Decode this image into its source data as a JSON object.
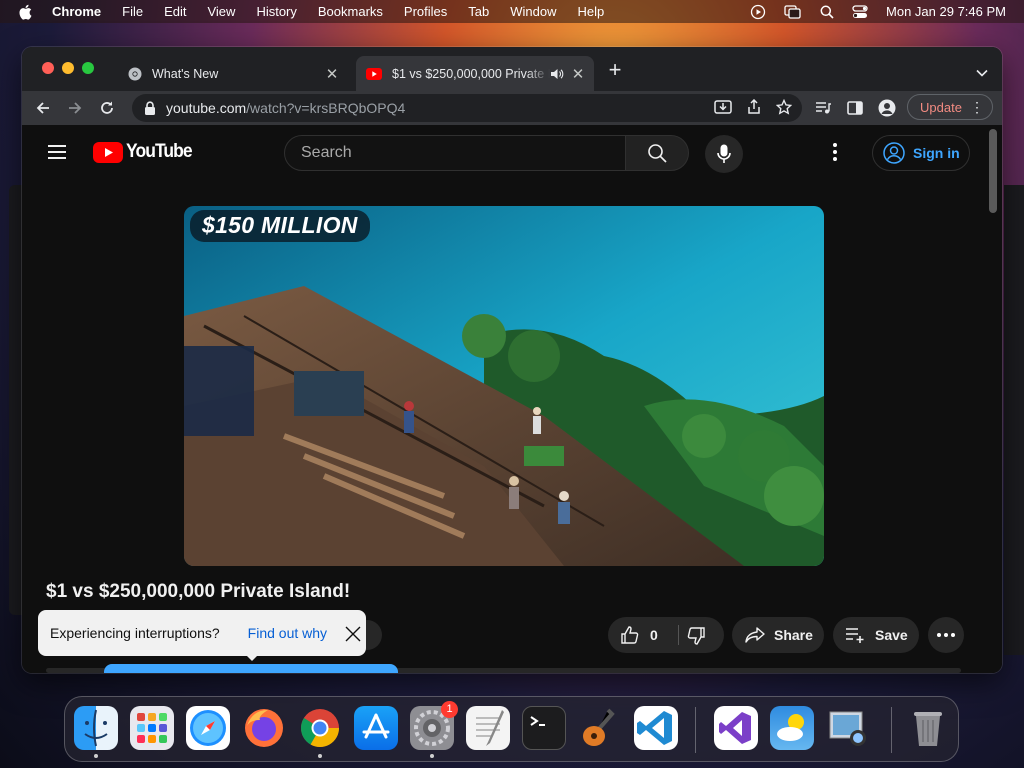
{
  "menubar": {
    "app_name": "Chrome",
    "items": [
      "File",
      "Edit",
      "View",
      "History",
      "Bookmarks",
      "Profiles",
      "Tab",
      "Window",
      "Help"
    ],
    "clock": "Mon Jan 29  7:46 PM"
  },
  "browser": {
    "tabs": [
      {
        "title": "What's New",
        "icon": "chrome-icon"
      },
      {
        "title": "$1 vs $250,000,000 Private Island!",
        "icon": "youtube-icon",
        "audio": "speaker-icon"
      }
    ],
    "url_host": "youtube.com",
    "url_path": "/watch?v=krsBRQbOPQ4",
    "update_label": "Update"
  },
  "youtube": {
    "logo_text": "YouTube",
    "search_placeholder": "Search",
    "signin_label": "Sign in",
    "thumbnail_badge": "$150 MILLION",
    "video_title": "$1 vs $250,000,000 Private Island!",
    "like_count": "0",
    "share_label": "Share",
    "save_label": "Save",
    "toast_message": "Experiencing interruptions?",
    "toast_link": "Find out why"
  },
  "dock": {
    "apps": [
      "Finder",
      "Launchpad",
      "Safari",
      "Firefox",
      "Chrome",
      "App Store",
      "System Settings",
      "TextEdit",
      "Terminal",
      "GarageBand",
      "Visual Studio Code",
      "Visual Studio",
      "Weather",
      "Preview",
      "Trash"
    ],
    "settings_badge": "1"
  },
  "colors": {
    "youtube_red": "#ff0000",
    "link_blue": "#3ea6ff",
    "update_text": "#f28b82"
  }
}
